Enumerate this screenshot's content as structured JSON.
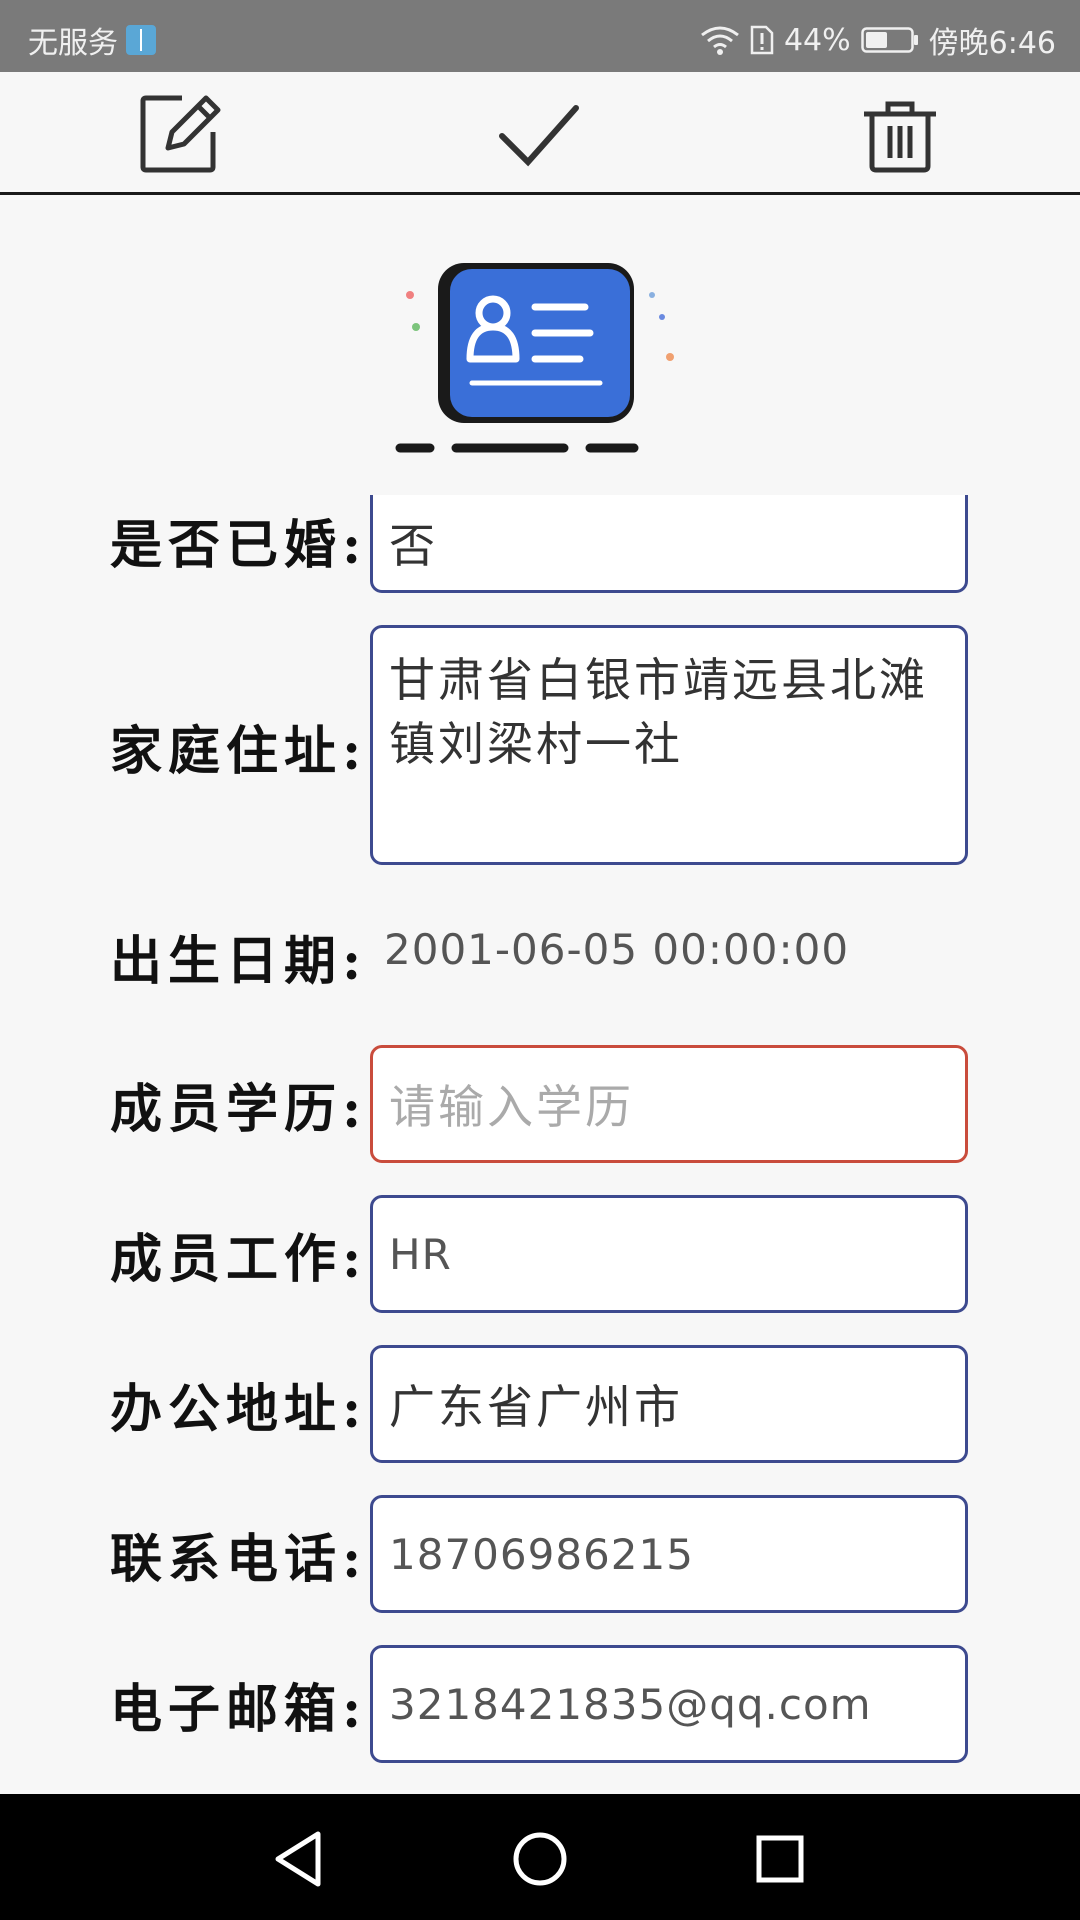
{
  "status_bar": {
    "carrier": "无服务",
    "battery_percent": "44%",
    "time": "傍晚6:46"
  },
  "toolbar": {
    "icons": [
      "edit-icon",
      "check-icon",
      "trash-icon"
    ]
  },
  "form": {
    "married": {
      "label": "是否已婚:",
      "value": "否"
    },
    "home_address": {
      "label": "家庭住址:",
      "value": "甘肃省白银市靖远县北滩镇刘梁村一社"
    },
    "birth_date": {
      "label": "出生日期:",
      "value": "2001-06-05 00:00:00"
    },
    "education": {
      "label": "成员学历:",
      "placeholder": "请输入学历"
    },
    "job": {
      "label": "成员工作:",
      "value": "HR"
    },
    "office_address": {
      "label": "办公地址:",
      "value": "广东省广州市"
    },
    "phone": {
      "label": "联系电话:",
      "value": "18706986215"
    },
    "email": {
      "label": "电子邮箱:",
      "value": "3218421835@qq.com"
    }
  },
  "colors": {
    "field_border": "#3d4a8f",
    "error_border": "#c94c3c",
    "logo_blue": "#3a6fd8"
  }
}
